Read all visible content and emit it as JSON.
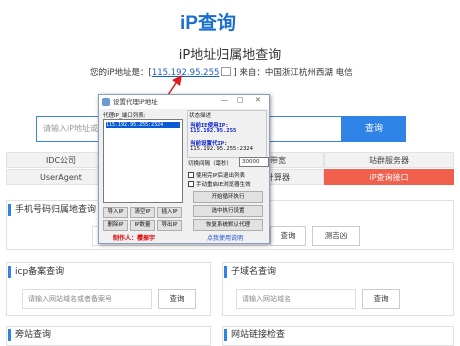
{
  "header": {
    "logo": "iP查询",
    "title": "iP地址归属地查询",
    "ip_prefix": "您的iP地址是：[",
    "ip_value": "115.192.95.255",
    "ip_suffix": "] 来自：中国浙江杭州西湖 电信"
  },
  "search": {
    "placeholder": "请输入iP地址或",
    "button": "查询"
  },
  "tabs": [
    {
      "label": "IDC公司",
      "active": false
    },
    {
      "label": "服务带宽",
      "active": false
    },
    {
      "label": "站群服务器",
      "active": false
    },
    {
      "label": "UserAgent",
      "active": false
    },
    {
      "label": "子网计算器",
      "active": false
    },
    {
      "label": "iP查询接口",
      "active": true
    }
  ],
  "phone_section": {
    "title": "手机号码归属地查询",
    "button_query": "查询",
    "button_test": "测吉凶"
  },
  "icp_section": {
    "title": "icp备案查询",
    "placeholder": "请输入网站域名或者备案号",
    "button": "查询"
  },
  "subdomain_section": {
    "title": "子域名查询",
    "placeholder": "请输入网站域名",
    "button": "查询"
  },
  "bottom_sections": {
    "left_title": "旁站查询",
    "right_title": "网站链接检查"
  },
  "dialog": {
    "title": "设置代理iP地址",
    "list_label": "代理IP_端口列表:",
    "list_items": [
      "115.192.95.255:2324"
    ],
    "buttons_row1": [
      "导入IP",
      "清空IP",
      "插入IP"
    ],
    "buttons_row2": [
      "删除IP",
      "IP数量",
      "导出IP"
    ],
    "author": "制作人：樱振宇",
    "status_label": "状态描述",
    "current_label": "当前IE使用IP:",
    "current_ip": "115.192.95.255",
    "set_label": "当前设置代IP:",
    "set_ip": "115.192.95.255:2324",
    "interval_label": "切换间隔（毫秒）",
    "interval_value": "30000",
    "check1": "使用完IP后退出列表",
    "check2": "手动重启IE浏览器生效",
    "btn_start": "开始循环执行",
    "btn_selected": "选中执行设置",
    "btn_restore": "恢复系统默认代理",
    "help": "点我使用说明"
  },
  "colors": {
    "accent": "#2f82e6",
    "active_tab": "#f0604c",
    "arrow": "#e01b1b",
    "author": "#dd0000"
  }
}
